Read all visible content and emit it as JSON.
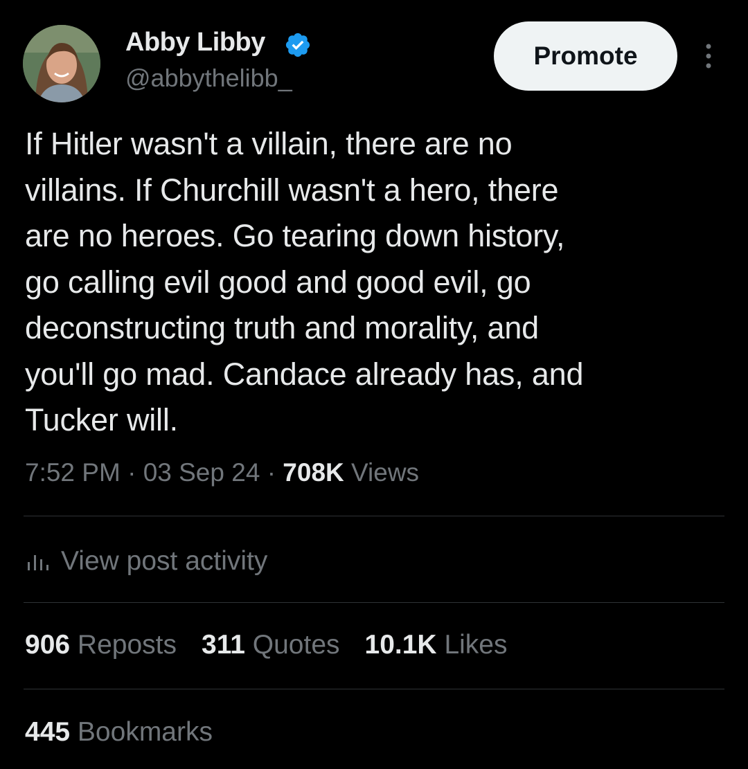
{
  "author": {
    "display_name": "Abby Libby",
    "handle": "@abbythelibb_",
    "verified_icon": "verified-badge-icon",
    "verified_color": "#1d9bf0"
  },
  "header": {
    "promote_label": "Promote",
    "more_icon": "more-vertical-icon"
  },
  "tweet": {
    "lines": [
      "If Hitler wasn't a villain, there are no",
      "villains. If Churchill wasn't a hero, there",
      "are no heroes. Go tearing down history,",
      "go calling evil good and good evil, go",
      "deconstructing truth and morality, and",
      "you'll go mad. Candace already has, and",
      "Tucker will."
    ]
  },
  "meta": {
    "time": "7:52 PM",
    "separator": "·",
    "date": "03 Sep 24",
    "views_count": "708K",
    "views_label": "Views"
  },
  "activity": {
    "label": "View post activity",
    "icon": "analytics-bars-icon"
  },
  "stats": {
    "reposts_count": "906",
    "reposts_label": "Reposts",
    "quotes_count": "311",
    "quotes_label": "Quotes",
    "likes_count": "10.1K",
    "likes_label": "Likes",
    "bookmarks_count": "445",
    "bookmarks_label": "Bookmarks"
  },
  "colors": {
    "background": "#000000",
    "text_primary": "#e7e9ea",
    "text_secondary": "#71767b",
    "divider": "#2f3336",
    "button_bg": "#eff3f4"
  }
}
